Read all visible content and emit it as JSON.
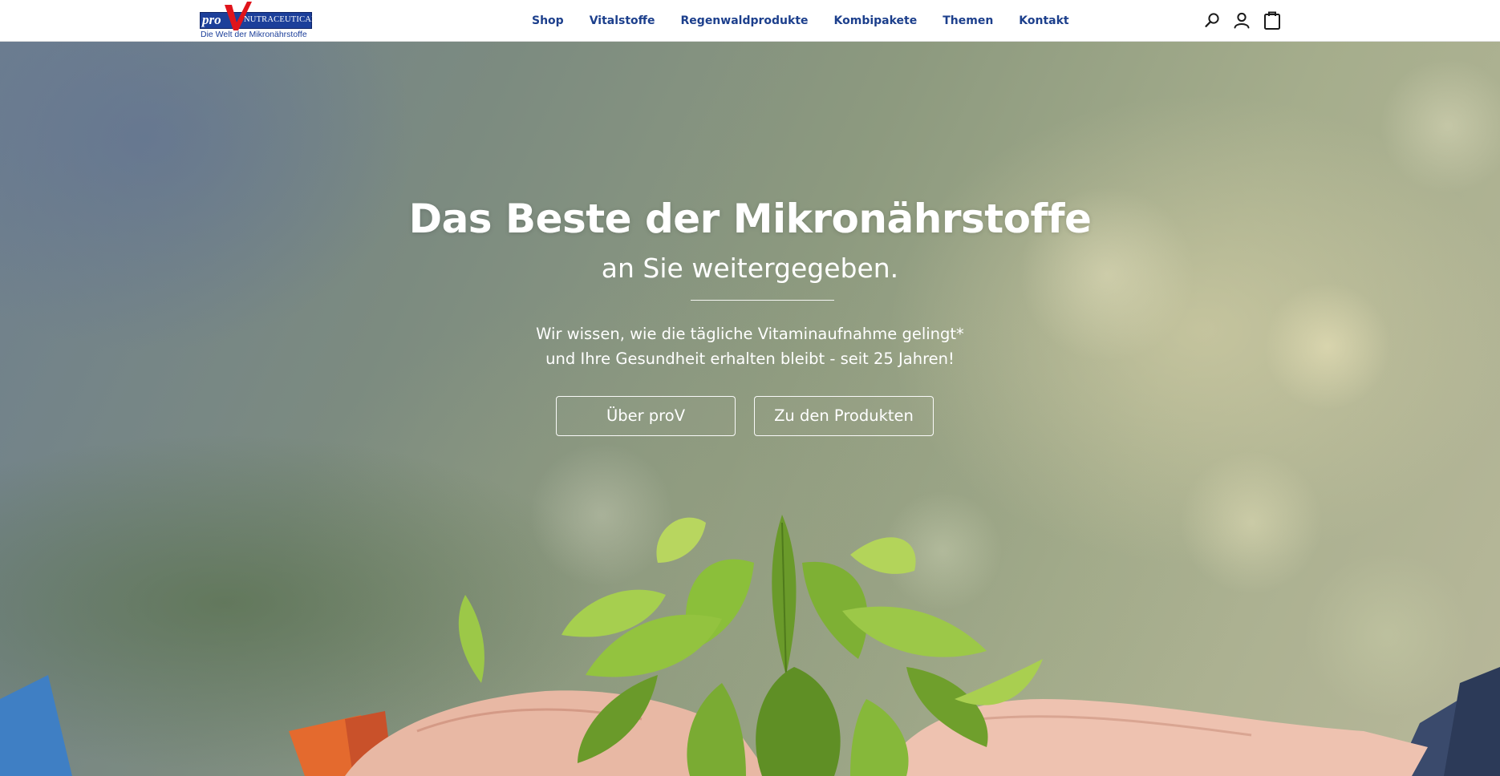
{
  "brand": {
    "logo_pro": "pro",
    "logo_v": "V",
    "logo_name": "NUTRACEUTICAL",
    "tagline": "Die Welt der Mikronährstoffe",
    "primary_color": "#1c3f9a",
    "accent_color": "#e0141b"
  },
  "nav": {
    "items": [
      {
        "label": "Shop"
      },
      {
        "label": "Vitalstoffe"
      },
      {
        "label": "Regenwaldprodukte"
      },
      {
        "label": "Kombipakete"
      },
      {
        "label": "Themen"
      },
      {
        "label": "Kontakt"
      }
    ]
  },
  "tools": {
    "icons": [
      "search-icon",
      "user-icon",
      "shopping-bag-icon"
    ]
  },
  "hero": {
    "title": "Das Beste der Mikronährstoffe",
    "subtitle": "an Sie weitergegeben.",
    "text_line1": "Wir wissen, wie die tägliche Vitaminaufnahme gelingt*",
    "text_line2": "und Ihre Gesundheit erhalten bleibt - seit 25 Jahren!",
    "button_about": "Über proV",
    "button_products": "Zu den Produkten"
  }
}
